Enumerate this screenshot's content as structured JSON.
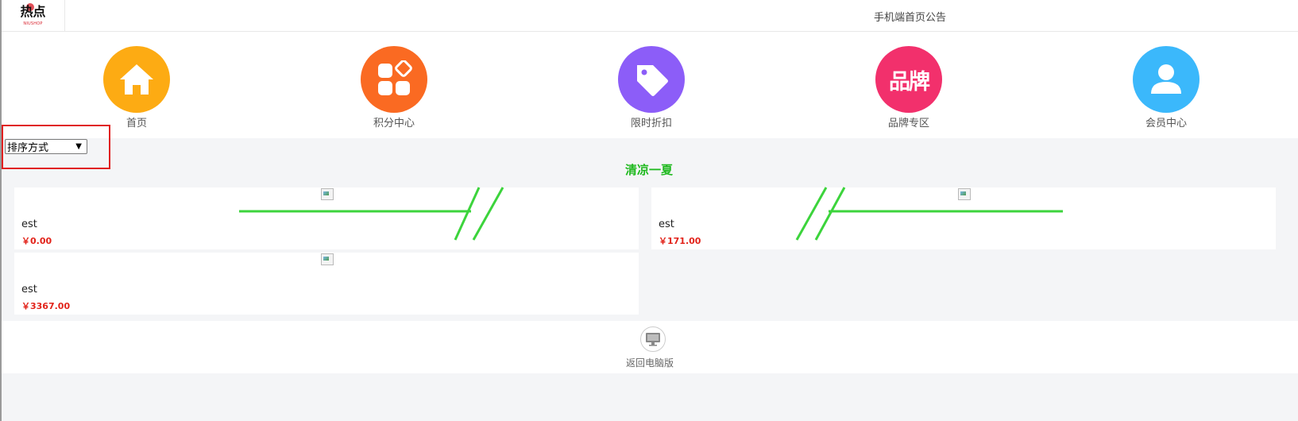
{
  "header": {
    "logo_text": "热点",
    "logo_sub": "NIUSHOP",
    "notice": "手机端首页公告"
  },
  "nav": {
    "items": [
      {
        "label": "首页",
        "icon": "home-icon",
        "color": "#fdab13"
      },
      {
        "label": "积分中心",
        "icon": "points-icon",
        "color": "#fa6a22"
      },
      {
        "label": "限时折扣",
        "icon": "tag-icon",
        "color": "#8c5df8"
      },
      {
        "label": "品牌专区",
        "icon": "brand-icon",
        "color": "#f2306c",
        "glyph": "品牌"
      },
      {
        "label": "会员中心",
        "icon": "user-icon",
        "color": "#3bb8fb"
      }
    ]
  },
  "sort": {
    "selected": "排序方式",
    "arrow": "▼"
  },
  "section": {
    "title": "清凉一夏"
  },
  "products": [
    {
      "name": "est",
      "price": "￥0.00"
    },
    {
      "name": "est",
      "price": "￥171.00"
    },
    {
      "name": "est",
      "price": "￥3367.00"
    }
  ],
  "footer": {
    "pc_label": "返回电脑版",
    "icon": "monitor-icon"
  },
  "colors": {
    "price": "#e2231a",
    "section_title": "#1fb91f",
    "highlight": "#e02020"
  }
}
